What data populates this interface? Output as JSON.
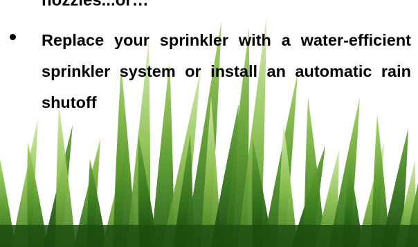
{
  "slide": {
    "previous_line": "nozzles...or…",
    "bullets": [
      {
        "text": "Replace your sprinkler with a water-efficient sprinkler system or install an automatic rain shutoff"
      }
    ]
  },
  "background": {
    "image": "grass",
    "colors": {
      "dark_green": "#1f5a12",
      "mid_green": "#4f8f24",
      "light_green": "#8dc050",
      "pale_green": "#c4e08f",
      "background": "#ffffff"
    }
  }
}
